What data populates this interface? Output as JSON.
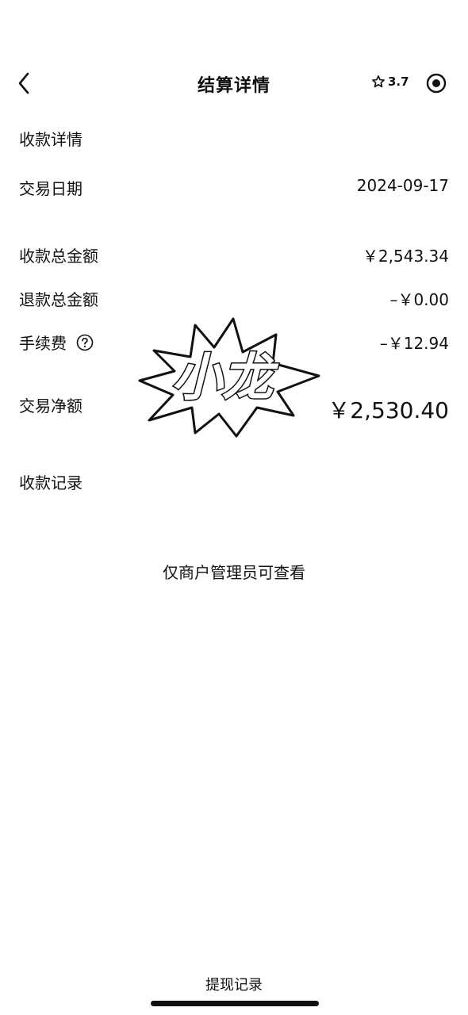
{
  "nav": {
    "title": "结算详情",
    "rating": "3.7",
    "back_icon": "chevron-left-icon",
    "rating_icon": "star-outline-icon",
    "more_icon": "record-target-icon"
  },
  "settlement": {
    "section_title": "收款详情",
    "date_label": "交易日期",
    "date_value": "2024-09-17",
    "total_label": "收款总金额",
    "total_value": "￥2,543.34",
    "refund_label": "退款总金额",
    "refund_value": "–￥0.00",
    "fee_label": "手续费",
    "fee_value": "–￥12.94",
    "net_label": "交易净额",
    "net_value": "￥2,530.40"
  },
  "records": {
    "title": "收款记录",
    "admin_note": "仅商户管理员可查看"
  },
  "watermark": {
    "text": "小龙"
  },
  "footer": {
    "withdraw_records": "提现记录"
  }
}
